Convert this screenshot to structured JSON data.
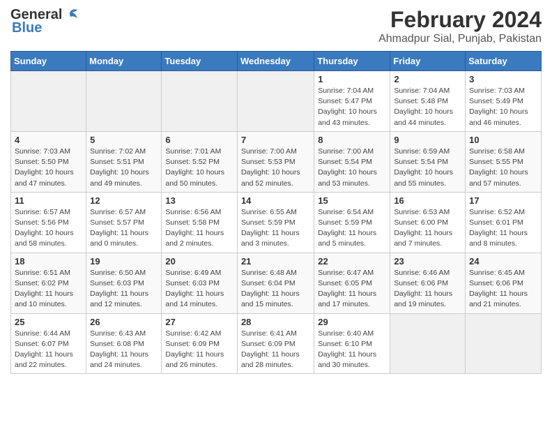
{
  "app": {
    "logo_general": "General",
    "logo_blue": "Blue"
  },
  "header": {
    "month_year": "February 2024",
    "location": "Ahmadpur Sial, Punjab, Pakistan"
  },
  "calendar": {
    "days_of_week": [
      "Sunday",
      "Monday",
      "Tuesday",
      "Wednesday",
      "Thursday",
      "Friday",
      "Saturday"
    ],
    "weeks": [
      [
        {
          "day": "",
          "info": ""
        },
        {
          "day": "",
          "info": ""
        },
        {
          "day": "",
          "info": ""
        },
        {
          "day": "",
          "info": ""
        },
        {
          "day": "1",
          "info": "Sunrise: 7:04 AM\nSunset: 5:47 PM\nDaylight: 10 hours\nand 43 minutes."
        },
        {
          "day": "2",
          "info": "Sunrise: 7:04 AM\nSunset: 5:48 PM\nDaylight: 10 hours\nand 44 minutes."
        },
        {
          "day": "3",
          "info": "Sunrise: 7:03 AM\nSunset: 5:49 PM\nDaylight: 10 hours\nand 46 minutes."
        }
      ],
      [
        {
          "day": "4",
          "info": "Sunrise: 7:03 AM\nSunset: 5:50 PM\nDaylight: 10 hours\nand 47 minutes."
        },
        {
          "day": "5",
          "info": "Sunrise: 7:02 AM\nSunset: 5:51 PM\nDaylight: 10 hours\nand 49 minutes."
        },
        {
          "day": "6",
          "info": "Sunrise: 7:01 AM\nSunset: 5:52 PM\nDaylight: 10 hours\nand 50 minutes."
        },
        {
          "day": "7",
          "info": "Sunrise: 7:00 AM\nSunset: 5:53 PM\nDaylight: 10 hours\nand 52 minutes."
        },
        {
          "day": "8",
          "info": "Sunrise: 7:00 AM\nSunset: 5:54 PM\nDaylight: 10 hours\nand 53 minutes."
        },
        {
          "day": "9",
          "info": "Sunrise: 6:59 AM\nSunset: 5:54 PM\nDaylight: 10 hours\nand 55 minutes."
        },
        {
          "day": "10",
          "info": "Sunrise: 6:58 AM\nSunset: 5:55 PM\nDaylight: 10 hours\nand 57 minutes."
        }
      ],
      [
        {
          "day": "11",
          "info": "Sunrise: 6:57 AM\nSunset: 5:56 PM\nDaylight: 10 hours\nand 58 minutes."
        },
        {
          "day": "12",
          "info": "Sunrise: 6:57 AM\nSunset: 5:57 PM\nDaylight: 11 hours\nand 0 minutes."
        },
        {
          "day": "13",
          "info": "Sunrise: 6:56 AM\nSunset: 5:58 PM\nDaylight: 11 hours\nand 2 minutes."
        },
        {
          "day": "14",
          "info": "Sunrise: 6:55 AM\nSunset: 5:59 PM\nDaylight: 11 hours\nand 3 minutes."
        },
        {
          "day": "15",
          "info": "Sunrise: 6:54 AM\nSunset: 5:59 PM\nDaylight: 11 hours\nand 5 minutes."
        },
        {
          "day": "16",
          "info": "Sunrise: 6:53 AM\nSunset: 6:00 PM\nDaylight: 11 hours\nand 7 minutes."
        },
        {
          "day": "17",
          "info": "Sunrise: 6:52 AM\nSunset: 6:01 PM\nDaylight: 11 hours\nand 8 minutes."
        }
      ],
      [
        {
          "day": "18",
          "info": "Sunrise: 6:51 AM\nSunset: 6:02 PM\nDaylight: 11 hours\nand 10 minutes."
        },
        {
          "day": "19",
          "info": "Sunrise: 6:50 AM\nSunset: 6:03 PM\nDaylight: 11 hours\nand 12 minutes."
        },
        {
          "day": "20",
          "info": "Sunrise: 6:49 AM\nSunset: 6:03 PM\nDaylight: 11 hours\nand 14 minutes."
        },
        {
          "day": "21",
          "info": "Sunrise: 6:48 AM\nSunset: 6:04 PM\nDaylight: 11 hours\nand 15 minutes."
        },
        {
          "day": "22",
          "info": "Sunrise: 6:47 AM\nSunset: 6:05 PM\nDaylight: 11 hours\nand 17 minutes."
        },
        {
          "day": "23",
          "info": "Sunrise: 6:46 AM\nSunset: 6:06 PM\nDaylight: 11 hours\nand 19 minutes."
        },
        {
          "day": "24",
          "info": "Sunrise: 6:45 AM\nSunset: 6:06 PM\nDaylight: 11 hours\nand 21 minutes."
        }
      ],
      [
        {
          "day": "25",
          "info": "Sunrise: 6:44 AM\nSunset: 6:07 PM\nDaylight: 11 hours\nand 22 minutes."
        },
        {
          "day": "26",
          "info": "Sunrise: 6:43 AM\nSunset: 6:08 PM\nDaylight: 11 hours\nand 24 minutes."
        },
        {
          "day": "27",
          "info": "Sunrise: 6:42 AM\nSunset: 6:09 PM\nDaylight: 11 hours\nand 26 minutes."
        },
        {
          "day": "28",
          "info": "Sunrise: 6:41 AM\nSunset: 6:09 PM\nDaylight: 11 hours\nand 28 minutes."
        },
        {
          "day": "29",
          "info": "Sunrise: 6:40 AM\nSunset: 6:10 PM\nDaylight: 11 hours\nand 30 minutes."
        },
        {
          "day": "",
          "info": ""
        },
        {
          "day": "",
          "info": ""
        }
      ]
    ]
  }
}
